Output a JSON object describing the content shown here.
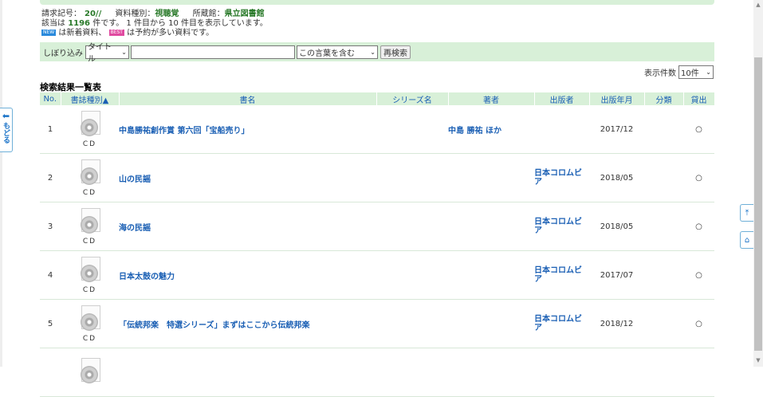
{
  "info": {
    "call_number_label": "請求記号：",
    "call_number_value": "20//",
    "material_type_label": "資料種別：",
    "material_type_value": "視聴覚",
    "holding_label": "所蔵館：",
    "holding_value": "県立図書館",
    "result_prefix": "該当は",
    "result_count": "1196",
    "result_suffix": "件です。 1 件目から 10 件目を表示しています。",
    "badge_new": "NEW",
    "new_note": "は新着資料、",
    "badge_best": "BEST",
    "best_note": "は予約が多い資料です。"
  },
  "filter": {
    "label": "しぼり込み",
    "field_select": "タイトル",
    "keyword_value": "",
    "mode_select": "この言葉を含む",
    "research_button": "再検索"
  },
  "perpage": {
    "label": "表示件数",
    "value": "10件"
  },
  "back_tab": {
    "label": "もどる"
  },
  "list_title": "検索結果一覧表",
  "columns": {
    "no": "No.",
    "type": "書誌種別▲",
    "title": "書名",
    "series": "シリーズ名",
    "author": "著者",
    "publisher": "出版者",
    "date": "出版年月",
    "class": "分類",
    "loan": "貸出"
  },
  "rows": [
    {
      "no": "1",
      "type": "CD",
      "title": "中島勝祐創作賞 第六回「宝船売り」",
      "series": "",
      "author": "中島 勝祐 ほか",
      "publisher": "",
      "date": "2017/12",
      "class": "",
      "loan": "○"
    },
    {
      "no": "2",
      "type": "CD",
      "title": "山の民謡",
      "series": "",
      "author": "",
      "publisher": "日本コロムビア",
      "date": "2018/05",
      "class": "",
      "loan": "○"
    },
    {
      "no": "3",
      "type": "CD",
      "title": "海の民謡",
      "series": "",
      "author": "",
      "publisher": "日本コロムビア",
      "date": "2018/05",
      "class": "",
      "loan": "○"
    },
    {
      "no": "4",
      "type": "CD",
      "title": "日本太鼓の魅力",
      "series": "",
      "author": "",
      "publisher": "日本コロムビア",
      "date": "2017/07",
      "class": "",
      "loan": "○"
    },
    {
      "no": "5",
      "type": "CD",
      "title": "「伝統邦楽　特選シリーズ」まずはここから伝統邦楽",
      "series": "",
      "author": "",
      "publisher": "日本コロムビア",
      "date": "2018/12",
      "class": "",
      "loan": "○"
    }
  ],
  "icons": {
    "back": "arrow-left-icon",
    "page_top": "page-top-icon",
    "home": "home-icon"
  }
}
